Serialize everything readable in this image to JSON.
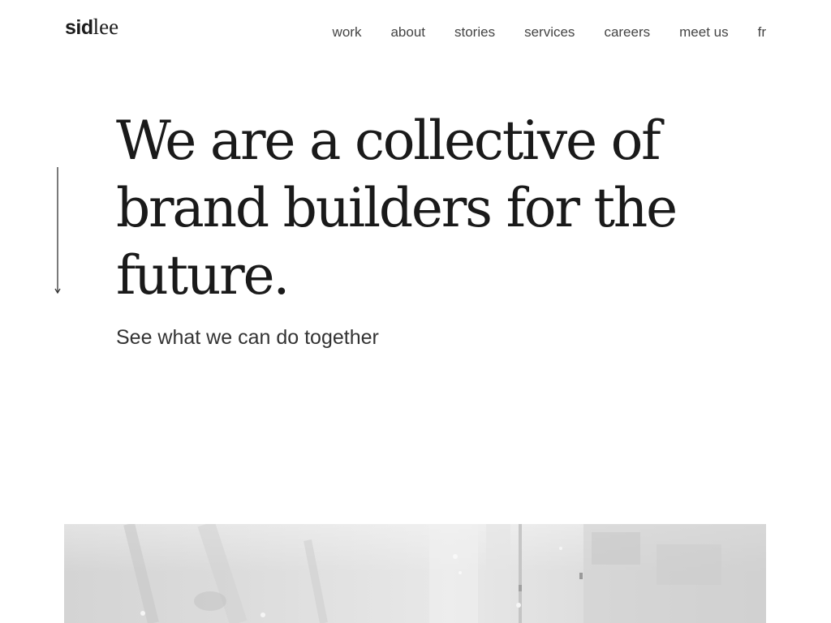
{
  "header": {
    "logo": {
      "part_bold": "sid",
      "part_serif": "lee"
    },
    "nav": [
      {
        "label": "work"
      },
      {
        "label": "about"
      },
      {
        "label": "stories"
      },
      {
        "label": "services"
      },
      {
        "label": "careers"
      },
      {
        "label": "meet us"
      },
      {
        "label": "fr"
      }
    ]
  },
  "hero": {
    "title": "We are a collective of brand builders for the future.",
    "subtitle": "See what we can do together"
  },
  "scroll_indicator": {
    "icon": "arrow-down-icon"
  },
  "media": {
    "description_icon": "aerial-city-video"
  },
  "colors": {
    "text": "#1c1c1c",
    "nav_text": "#444444",
    "media_bg": "#d9d9d9",
    "background": "#ffffff"
  }
}
